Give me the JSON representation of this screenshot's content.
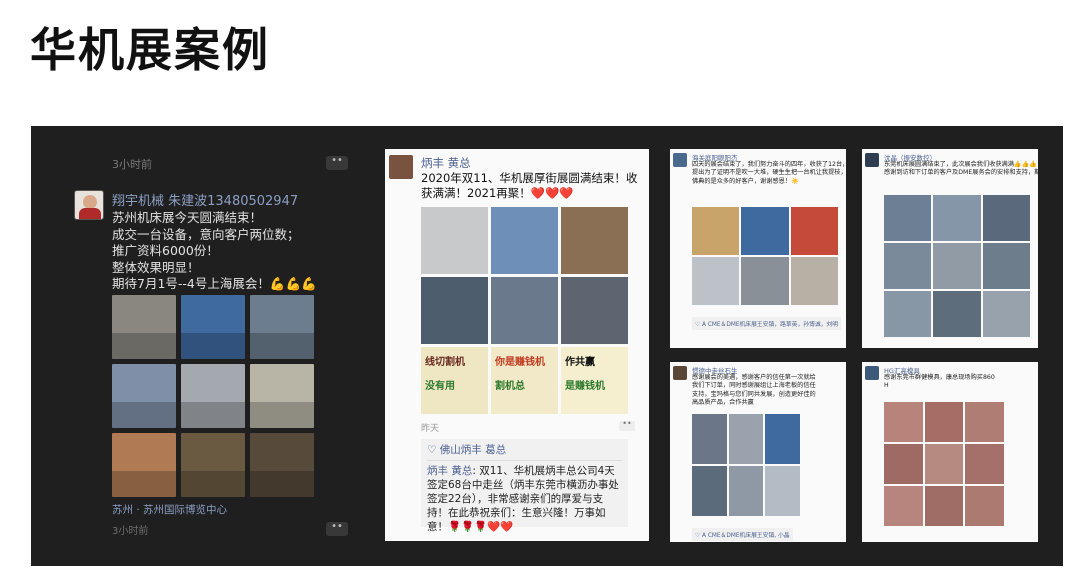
{
  "title": "华机展案例",
  "left_post": {
    "time_top": "3小时前",
    "more": "••",
    "user": "翔宇机械 朱建波13480502947",
    "lines": [
      "苏州机床展今天圆满结束！",
      "成交一台设备，意向客户两位数；",
      "推广资料6000份！",
      "整体效果明显！",
      "期待7月1号--4号上海展会！💪💪💪"
    ],
    "location": "苏州 · 苏州国际博览中心",
    "time_bottom": "3小时前",
    "photo_colors": [
      "#8a8780",
      "#3f6aa0",
      "#6b7d8e",
      "#7f8fa8",
      "#a4a9b0",
      "#b8b4a6",
      "#b07a55",
      "#6b5a42",
      "#574a3a"
    ]
  },
  "card_big": {
    "name": "炳丰 黄总",
    "text": "2020年双11、华机展厚街展圆满结束！收获满满！2021再聚！❤️❤️❤️",
    "photo_colors": [
      "#c7c9cb",
      "#6d8fb8",
      "#8a6f55",
      "#4e5d6e",
      "#6a7a8c",
      "#5d6670",
      "#efe6c4",
      "#f2e9c8",
      "#f5efd0"
    ],
    "ad_texts": [
      "线切割机",
      "没有用",
      "你是赚钱机",
      "割机总",
      "作共赢",
      "是赚钱机"
    ],
    "meta": "昨天",
    "more": "••",
    "like": "♡ 佛山炳丰 葛总",
    "comment_name": "炳丰 黄总",
    "comment_text": ": 双11、华机展炳丰总公司4天签定68台中走丝（炳丰东莞市横沥办事处签定22台），非常感谢亲们的厚爱与支持！在此恭祝亲们：生意兴隆！万事如意！",
    "comment_emoji": "🌹🌹🌹❤️❤️"
  },
  "card_tl": {
    "name": "海关庭阳眼阳杰",
    "lines": [
      "四天的展会结束了，我们努力奋斗的四年，收获了12台，佛一台😊",
      "提出为了证明不是吹一大堆，硬生生把一台机让我提枝，非常感谢各位！",
      "佛典的是众多的好客户，谢谢感恩！☀️"
    ],
    "footer": "♡ A CME＆DME机床展王安镇，路草英，孙博诚，刘明",
    "photo_colors": [
      "#c9a46a",
      "#3f6aa0",
      "#c64a3a",
      "#bcc2c8",
      "#8a9098",
      "#b7b0a5"
    ]
  },
  "card_tr": {
    "name": "沈晶（振安数控）",
    "lines": [
      "东莞机床展圆满结束了，此次展会我们收获满满👍👍👍，",
      "感谢到访和下订单的客户及DME展务会的安排和支持，期待年11在见😊😊"
    ],
    "photo_colors": [
      "#6d7f95",
      "#8496a8",
      "#5a6a7c",
      "#7b8a9a",
      "#909ba6",
      "#6e7d8c",
      "#8897a6",
      "#5e6d7c",
      "#97a2ad"
    ]
  },
  "card_bl": {
    "name": "惯德中走丝石生",
    "lines": [
      "感谢展会的美遇，感谢客户的信任第一次就给",
      "我们下订单，同时感谢展组让上海老板的信任",
      "支持，宝玛格与您们同共发展，创造更好佳的",
      "高品质产品，合作共赢"
    ],
    "footer": "♡ A CME＆DME机床展王安镇, 小晶",
    "photo_colors": [
      "#6b7788",
      "#9aa3ad",
      "#3f6aa0",
      "#5c6b7c",
      "#8e99a5",
      "#b3bbc4"
    ]
  },
  "card_br": {
    "name": "HG汇高模具",
    "lines": [
      "感谢东莞市群健模具，康总现场购买860",
      "H"
    ],
    "photo_colors": [
      "#b8837a",
      "#a56d66",
      "#b07d75",
      "#9e6a63",
      "#b58a81",
      "#a47069",
      "#b7857d",
      "#a06d66",
      "#ad7a72"
    ]
  }
}
